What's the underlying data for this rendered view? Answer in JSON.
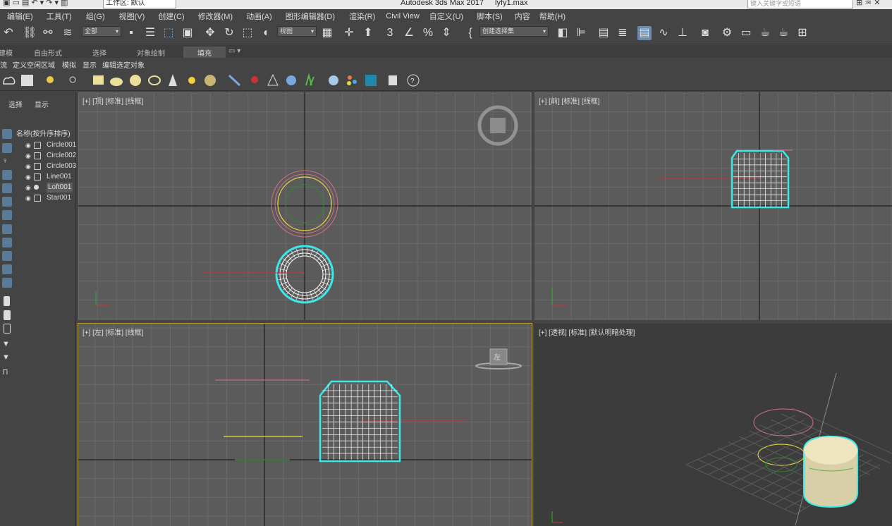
{
  "title_bar": {
    "workspace": "工作区: 默认",
    "app_title": "Autodesk 3ds Max 2017",
    "file_name": "lyfy1.max",
    "search_placeholder": "键入关键字或短语"
  },
  "menu": [
    "编辑(E)",
    "工具(T)",
    "组(G)",
    "视图(V)",
    "创建(C)",
    "修改器(M)",
    "动画(A)",
    "图形编辑器(D)",
    "渲染(R)",
    "Civil View",
    "自定义(U)",
    "脚本(S)",
    "内容",
    "帮助(H)"
  ],
  "main_toolbar": {
    "selection_filter": "全部",
    "ref_coord": "视图",
    "named_selection": "创建选择集"
  },
  "ribbon_tabs": [
    "建模",
    "自由形式",
    "选择",
    "对象绘制",
    "填充"
  ],
  "ribbon_active": "填充",
  "explorer_menu": [
    "流",
    "定义空闲区域",
    "模拟",
    "显示",
    "编辑选定对象"
  ],
  "scene_explorer": {
    "tabs": [
      "选择",
      "显示"
    ],
    "column_header": "名称(按升序排序)",
    "objects": [
      {
        "name": "Circle001",
        "type": "shape",
        "selected": false
      },
      {
        "name": "Circle002",
        "type": "shape",
        "selected": false
      },
      {
        "name": "Circle003",
        "type": "shape",
        "selected": false
      },
      {
        "name": "Line001",
        "type": "shape",
        "selected": false
      },
      {
        "name": "Loft001",
        "type": "geometry",
        "selected": true
      },
      {
        "name": "Star001",
        "type": "shape",
        "selected": false
      }
    ]
  },
  "viewports": {
    "top": {
      "label": "[+] [顶] [标准] [线框]"
    },
    "front": {
      "label": "[+] [前] [标准] [线框]"
    },
    "left": {
      "label": "[+] [左] [标准] [线框]",
      "viewcube_face": "左",
      "active": true
    },
    "perspective": {
      "label": "[+] [透视] [标准] [默认明暗处理]"
    }
  },
  "colors": {
    "viewport_bg": "#5b5b5b",
    "persp_bg": "#3c3c3c",
    "grid": "#6d6d6d",
    "selected_wire": "#3de8e8",
    "active_border": "#b9a23a"
  }
}
